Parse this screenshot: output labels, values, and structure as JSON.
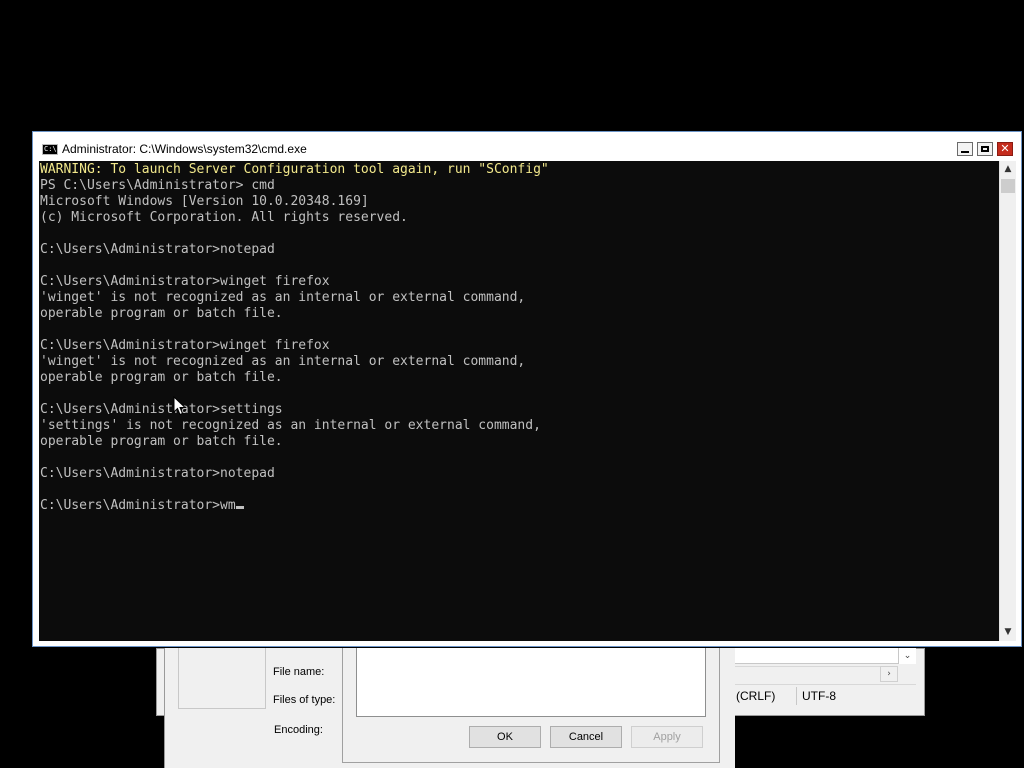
{
  "console": {
    "title": "Administrator: C:\\Windows\\system32\\cmd.exe",
    "icon_text": "C:\\",
    "lines": [
      "WARNING: To launch Server Configuration tool again, run \"SConfig\"",
      "PS C:\\Users\\Administrator> cmd",
      "Microsoft Windows [Version 10.0.20348.169]",
      "(c) Microsoft Corporation. All rights reserved.",
      "",
      "C:\\Users\\Administrator>notepad",
      "",
      "C:\\Users\\Administrator>winget firefox",
      "'winget' is not recognized as an internal or external command,",
      "operable program or batch file.",
      "",
      "C:\\Users\\Administrator>winget firefox",
      "'winget' is not recognized as an internal or external command,",
      "operable program or batch file.",
      "",
      "C:\\Users\\Administrator>settings",
      "'settings' is not recognized as an internal or external command,",
      "operable program or batch file.",
      "",
      "C:\\Users\\Administrator>notepad",
      ""
    ],
    "prompt": "C:\\Users\\Administrator>",
    "current_input": "wm",
    "colors": {
      "background": "#0c0c0c",
      "text": "#c0c0c0",
      "warning": "#f2e88b"
    }
  },
  "save_dialog": {
    "file_name_label": "File name:",
    "files_of_type_label": "Files of type:",
    "encoding_label": "Encoding:",
    "ok_label": "OK",
    "cancel_label": "Cancel",
    "apply_label": "Apply"
  },
  "notepad_status": {
    "line_ending": "(CRLF)",
    "encoding": "UTF-8"
  },
  "icons": {
    "scroll_up": "▲",
    "scroll_down": "▼",
    "scroll_right": "›",
    "dropdown": "⌄",
    "close": "✕"
  }
}
